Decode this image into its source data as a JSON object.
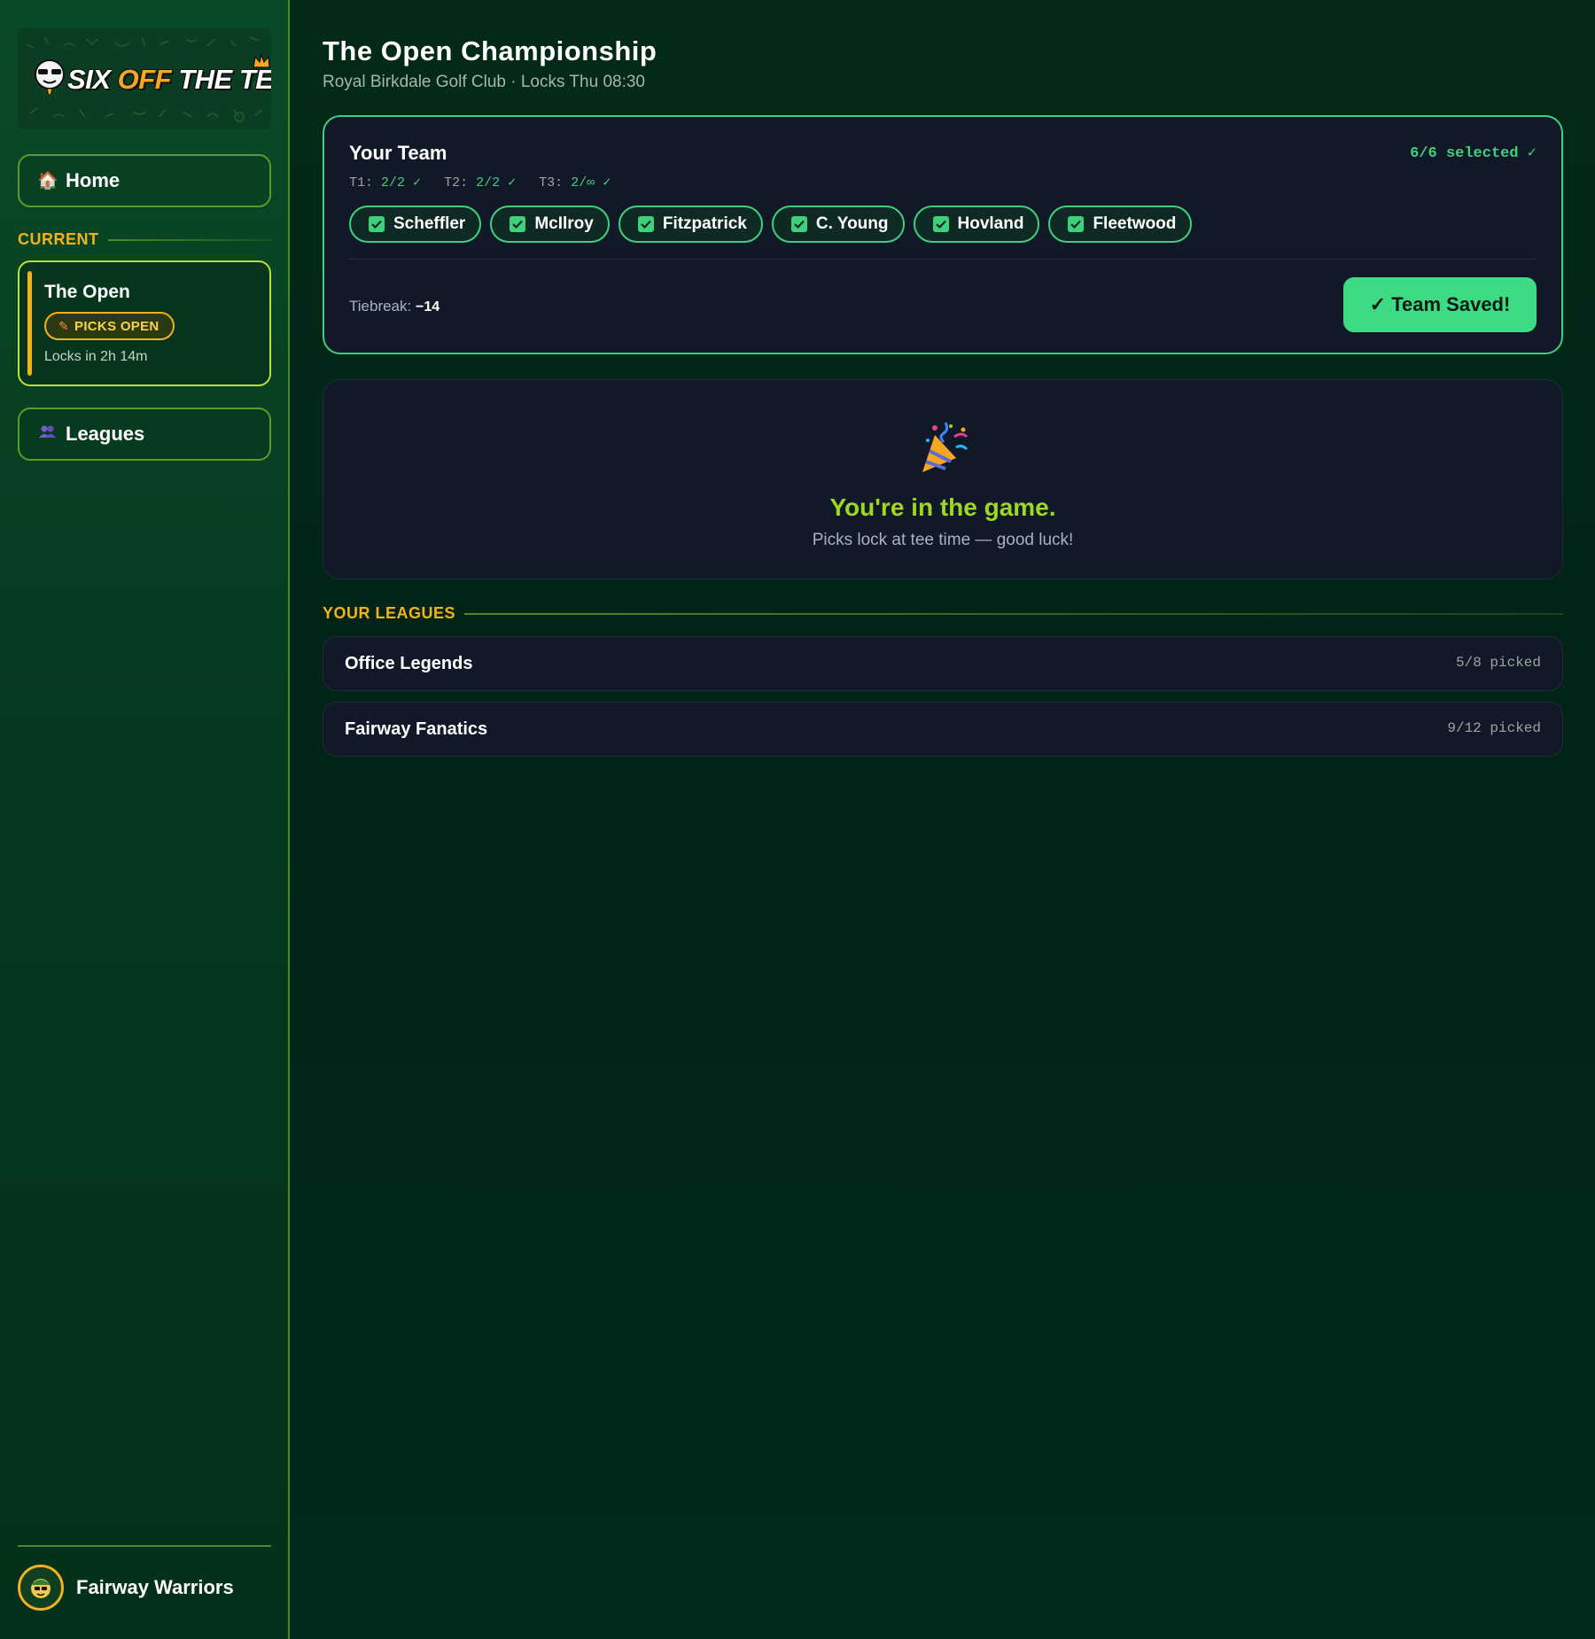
{
  "sidebar": {
    "logo": {
      "text_white": "SIX",
      "text_orange": "OFF",
      "text_white2": "THE TEE"
    },
    "home_icon": "house-icon",
    "home_label": "Home",
    "current_label": "CURRENT",
    "current_event": {
      "title": "The Open",
      "badge": "PICKS OPEN",
      "badge_icon": "pencil-icon",
      "locks": "Locks in 2h 14m"
    },
    "leagues_icon": "people-icon",
    "leagues_label": "Leagues",
    "user": {
      "name": "Fairway Warriors",
      "avatar_icon": "golfer-emoji-icon"
    }
  },
  "header": {
    "title": "The Open Championship",
    "subtitle": "Royal Birkdale Golf Club · Locks Thu 08:30"
  },
  "team": {
    "heading": "Your Team",
    "selected": "6/6 selected ✓",
    "tiers": [
      {
        "label": "T1:",
        "value": "2/2 ✓"
      },
      {
        "label": "T2:",
        "value": "2/2 ✓"
      },
      {
        "label": "T3:",
        "value": "2/∞ ✓"
      }
    ],
    "players": [
      "Scheffler",
      "McIlroy",
      "Fitzpatrick",
      "C. Young",
      "Hovland",
      "Fleetwood"
    ],
    "tiebreak_label": "Tiebreak:",
    "tiebreak_value": "−14",
    "save_label": "✓ Team Saved!"
  },
  "celebrate": {
    "icon": "party-popper-icon",
    "message": "You're in the game.",
    "sub": "Picks lock at tee time — good luck!"
  },
  "leagues": {
    "label": "YOUR LEAGUES",
    "items": [
      {
        "name": "Office Legends",
        "picked": "5/8 picked"
      },
      {
        "name": "Fairway Fanatics",
        "picked": "9/12 picked"
      }
    ]
  },
  "colors": {
    "accent_green": "#3fd07c",
    "accent_gold": "#f2b21b",
    "lime": "#9ed81f",
    "card_bg": "#111827"
  }
}
